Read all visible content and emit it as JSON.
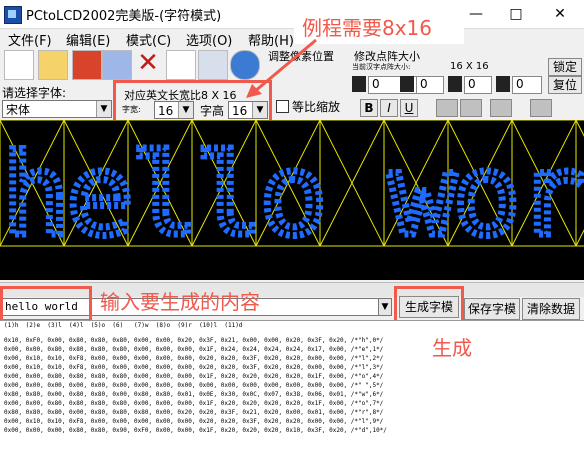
{
  "window": {
    "title": "PCtoLCD2002完美版-(字符模式)",
    "minimize": "—",
    "maximize": "□",
    "close": "✕"
  },
  "menu": [
    {
      "label": "文件(F)"
    },
    {
      "label": "编辑(E)"
    },
    {
      "label": "模式(C)"
    },
    {
      "label": "选项(O)"
    },
    {
      "label": "帮助(H)"
    }
  ],
  "toolbar": {
    "adjust_pixel_label": "调整像素位置",
    "dot_size_label": "修改点阵大小",
    "current_size_label": "当前汉字点阵大小:",
    "current_size_value": "16 X 16",
    "lock_button": "锁定",
    "restore_button": "复位",
    "spin_values": [
      "0",
      "0",
      "0",
      "0",
      "0"
    ]
  },
  "font_row": {
    "select_font_label": "请选择字体:",
    "font_value": "宋体",
    "ascii_size_label": "对应英文长宽比8 X 16",
    "width_label": "字宽:",
    "width_value": "16",
    "height_label": "字高",
    "height_value": "16",
    "proportional_label": "等比缩放",
    "bold": "B",
    "italic": "I",
    "underline": "U"
  },
  "annotations": {
    "top": "例程需要8x16",
    "input": "输入要生成的内容",
    "generate": "生成"
  },
  "preview": {
    "text": "hello wor",
    "dot_color": "#1f6bff",
    "grid_color": "#e6e600"
  },
  "input": {
    "value": "hello world"
  },
  "actions": {
    "generate": "生成字模",
    "save": "保存字模",
    "clear": "清除数据"
  },
  "output": {
    "index_line": "(1)h  (2)e  (3)l  (4)l  (5)o  (6)   (7)w  (8)o  (9)r  (10)l  (11)d",
    "lines": [
      "0x10, 0xF0, 0x00, 0x80, 0x80, 0x80, 0x00, 0x00, 0x20, 0x3F, 0x21, 0x00, 0x00, 0x20, 0x3F, 0x20, /*\"h\",0*/",
      "0x00, 0x00, 0x80, 0x80, 0x80, 0x80, 0x00, 0x00, 0x00, 0x1F, 0x24, 0x24, 0x24, 0x24, 0x17, 0x00, /*\"e\",1*/",
      "0x00, 0x10, 0x10, 0xF8, 0x00, 0x00, 0x00, 0x00, 0x00, 0x20, 0x20, 0x3F, 0x20, 0x20, 0x00, 0x00, /*\"l\",2*/",
      "0x00, 0x10, 0x10, 0xF8, 0x00, 0x00, 0x00, 0x00, 0x00, 0x20, 0x20, 0x3F, 0x20, 0x20, 0x00, 0x00, /*\"l\",3*/",
      "0x00, 0x00, 0x80, 0x80, 0x80, 0x80, 0x00, 0x00, 0x00, 0x1F, 0x20, 0x20, 0x20, 0x20, 0x1F, 0x00, /*\"o\",4*/",
      "0x00, 0x00, 0x00, 0x00, 0x00, 0x00, 0x00, 0x00, 0x00, 0x00, 0x00, 0x00, 0x00, 0x00, 0x00, 0x00, /*\" \",5*/",
      "0x80, 0x80, 0x00, 0x80, 0x80, 0x00, 0x80, 0x80, 0x01, 0x0E, 0x30, 0x0C, 0x07, 0x38, 0x06, 0x01, /*\"w\",6*/",
      "0x00, 0x00, 0x80, 0x80, 0x80, 0x80, 0x00, 0x00, 0x00, 0x1F, 0x20, 0x20, 0x20, 0x20, 0x1F, 0x00, /*\"o\",7*/",
      "0x80, 0x80, 0x80, 0x00, 0x80, 0x80, 0x80, 0x00, 0x20, 0x20, 0x3F, 0x21, 0x20, 0x00, 0x01, 0x00, /*\"r\",8*/",
      "0x00, 0x10, 0x10, 0xF8, 0x00, 0x00, 0x00, 0x00, 0x00, 0x20, 0x20, 0x3F, 0x20, 0x20, 0x00, 0x00, /*\"l\",9*/",
      "0x00, 0x00, 0x00, 0x80, 0x80, 0x90, 0xF0, 0x00, 0x00, 0x1F, 0x20, 0x20, 0x20, 0x10, 0x3F, 0x20, /*\"d\",10*/"
    ]
  }
}
